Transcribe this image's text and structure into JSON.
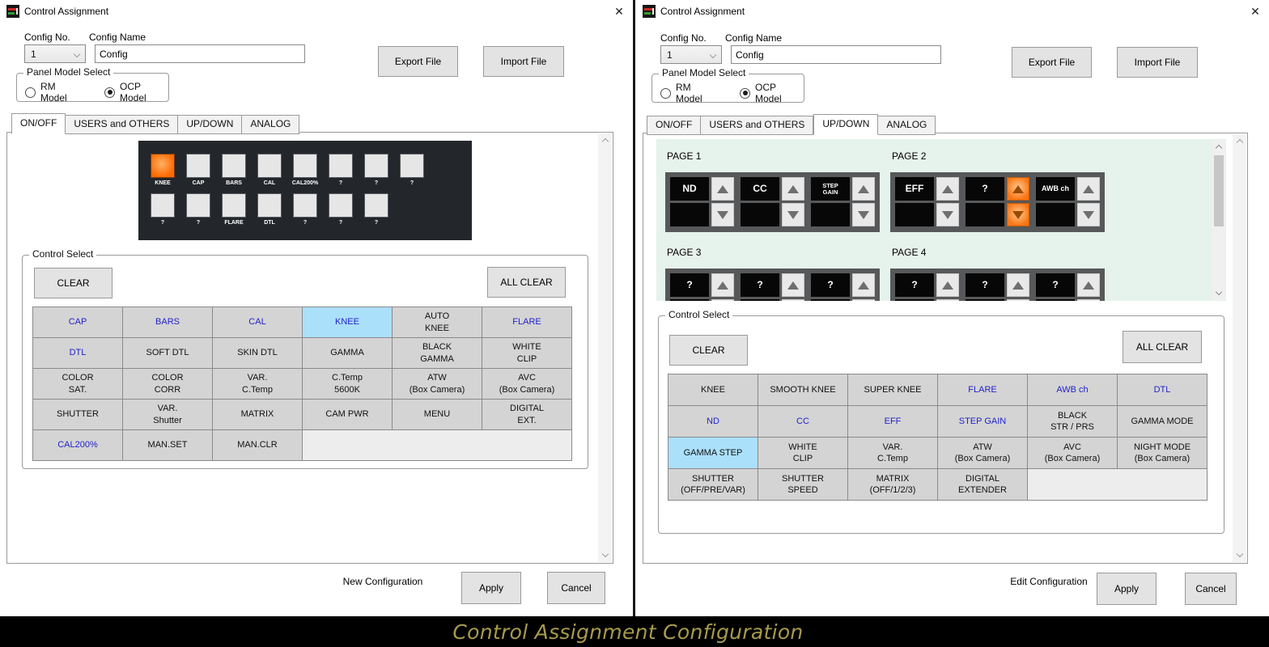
{
  "banner": {
    "text": "Control Assignment Configuration",
    "color": "#a89a4c"
  },
  "icons": {
    "close": "✕",
    "combo_chevron": "v"
  },
  "colors": {
    "active_orange": "#ff6a00",
    "assigned_blue": "#2222cc",
    "selected_cell_bg": "#abe0fb",
    "pane_green": "#e6f2ec",
    "panel_dark": "#23262b"
  },
  "windows": [
    {
      "title": "Control Assignment",
      "config_no": {
        "label": "Config No.",
        "value": "1"
      },
      "config_name": {
        "label": "Config Name",
        "value": "Config"
      },
      "export_label": "Export File",
      "import_label": "Import File",
      "panel_model": {
        "legend": "Panel Model Select",
        "options": [
          {
            "label": "RM Model",
            "selected": false
          },
          {
            "label": "OCP Model",
            "selected": true
          }
        ]
      },
      "tabs": [
        {
          "label": "ON/OFF",
          "selected": true
        },
        {
          "label": "USERS and OTHERS",
          "selected": false
        },
        {
          "label": "UP/DOWN",
          "selected": false
        },
        {
          "label": "ANALOG",
          "selected": false
        }
      ],
      "panel_rows": [
        [
          {
            "label": "KNEE",
            "active": true
          },
          {
            "label": "CAP"
          },
          {
            "label": "BARS"
          },
          {
            "label": "CAL"
          },
          {
            "label": "CAL200%"
          },
          {
            "label": "?"
          },
          {
            "label": "?"
          },
          {
            "label": "?"
          }
        ],
        [
          {
            "label": "?"
          },
          {
            "label": "?"
          },
          {
            "label": "FLARE"
          },
          {
            "label": "DTL"
          },
          {
            "label": "?"
          },
          {
            "label": "?"
          },
          {
            "label": "?"
          }
        ]
      ],
      "control_select": {
        "legend": "Control Select",
        "clear_label": "CLEAR",
        "all_clear_label": "ALL CLEAR",
        "rows": [
          [
            {
              "label": "CAP",
              "state": "assigned"
            },
            {
              "label": "BARS",
              "state": "assigned"
            },
            {
              "label": "CAL",
              "state": "assigned"
            },
            {
              "label": "KNEE",
              "state": "assigned selected"
            },
            {
              "label": "AUTO\nKNEE"
            },
            {
              "label": "FLARE",
              "state": "assigned"
            }
          ],
          [
            {
              "label": "DTL",
              "state": "assigned"
            },
            {
              "label": "SOFT DTL"
            },
            {
              "label": "SKIN DTL"
            },
            {
              "label": "GAMMA"
            },
            {
              "label": "BLACK\nGAMMA"
            },
            {
              "label": "WHITE\nCLIP"
            }
          ],
          [
            {
              "label": "COLOR\nSAT."
            },
            {
              "label": "COLOR\nCORR"
            },
            {
              "label": "VAR.\nC.Temp"
            },
            {
              "label": "C.Temp\n5600K"
            },
            {
              "label": "ATW\n(Box Camera)"
            },
            {
              "label": "AVC\n(Box Camera)"
            }
          ],
          [
            {
              "label": "SHUTTER"
            },
            {
              "label": "VAR.\nShutter"
            },
            {
              "label": "MATRIX"
            },
            {
              "label": "CAM PWR"
            },
            {
              "label": "MENU"
            },
            {
              "label": "DIGITAL\nEXT."
            }
          ],
          [
            {
              "label": "CAL200%",
              "state": "assigned"
            },
            {
              "label": "MAN.SET"
            },
            {
              "label": "MAN.CLR"
            }
          ]
        ],
        "empty_span": 3
      },
      "footer": {
        "status": "New Configuration",
        "apply_label": "Apply",
        "cancel_label": "Cancel"
      }
    },
    {
      "title": "Control Assignment",
      "config_no": {
        "label": "Config No.",
        "value": "1"
      },
      "config_name": {
        "label": "Config Name",
        "value": "Config"
      },
      "export_label": "Export File",
      "import_label": "Import File",
      "panel_model": {
        "legend": "Panel Model Select",
        "options": [
          {
            "label": "RM Model",
            "selected": false
          },
          {
            "label": "OCP Model",
            "selected": true
          }
        ]
      },
      "tabs": [
        {
          "label": "ON/OFF",
          "selected": false
        },
        {
          "label": "USERS and OTHERS",
          "selected": false
        },
        {
          "label": "UP/DOWN",
          "selected": true
        },
        {
          "label": "ANALOG",
          "selected": false
        }
      ],
      "pages": [
        {
          "name": "PAGE 1",
          "modules": [
            {
              "label": "ND"
            },
            {
              "label": "CC"
            },
            {
              "label": "STEP\nGAIN"
            }
          ]
        },
        {
          "name": "PAGE 2",
          "modules": [
            {
              "label": "EFF"
            },
            {
              "label": "?",
              "active": true
            },
            {
              "label": "AWB ch"
            }
          ]
        },
        {
          "name": "PAGE 3",
          "modules": [
            {
              "label": "?"
            },
            {
              "label": "?"
            },
            {
              "label": "?"
            }
          ]
        },
        {
          "name": "PAGE 4",
          "modules": [
            {
              "label": "?"
            },
            {
              "label": "?"
            },
            {
              "label": "?"
            }
          ]
        }
      ],
      "control_select": {
        "legend": "Control Select",
        "clear_label": "CLEAR",
        "all_clear_label": "ALL CLEAR",
        "rows": [
          [
            {
              "label": "KNEE"
            },
            {
              "label": "SMOOTH KNEE"
            },
            {
              "label": "SUPER KNEE"
            },
            {
              "label": "FLARE",
              "state": "assigned"
            },
            {
              "label": "AWB ch",
              "state": "assigned"
            },
            {
              "label": "DTL",
              "state": "assigned"
            }
          ],
          [
            {
              "label": "ND",
              "state": "assigned"
            },
            {
              "label": "CC",
              "state": "assigned"
            },
            {
              "label": "EFF",
              "state": "assigned"
            },
            {
              "label": "STEP GAIN",
              "state": "assigned"
            },
            {
              "label": "BLACK\nSTR / PRS"
            },
            {
              "label": "GAMMA MODE"
            }
          ],
          [
            {
              "label": "GAMMA STEP",
              "state": "selected"
            },
            {
              "label": "WHITE\nCLIP"
            },
            {
              "label": "VAR.\nC.Temp"
            },
            {
              "label": "ATW\n(Box Camera)"
            },
            {
              "label": "AVC\n(Box Camera)"
            },
            {
              "label": "NIGHT MODE\n(Box Camera)"
            }
          ],
          [
            {
              "label": "SHUTTER\n(OFF/PRE/VAR)"
            },
            {
              "label": "SHUTTER\nSPEED"
            },
            {
              "label": "MATRIX\n(OFF/1/2/3)"
            },
            {
              "label": "DIGITAL\nEXTENDER"
            }
          ]
        ],
        "empty_span": 2
      },
      "footer": {
        "status": "Edit Configuration",
        "apply_label": "Apply",
        "cancel_label": "Cancel"
      }
    }
  ]
}
